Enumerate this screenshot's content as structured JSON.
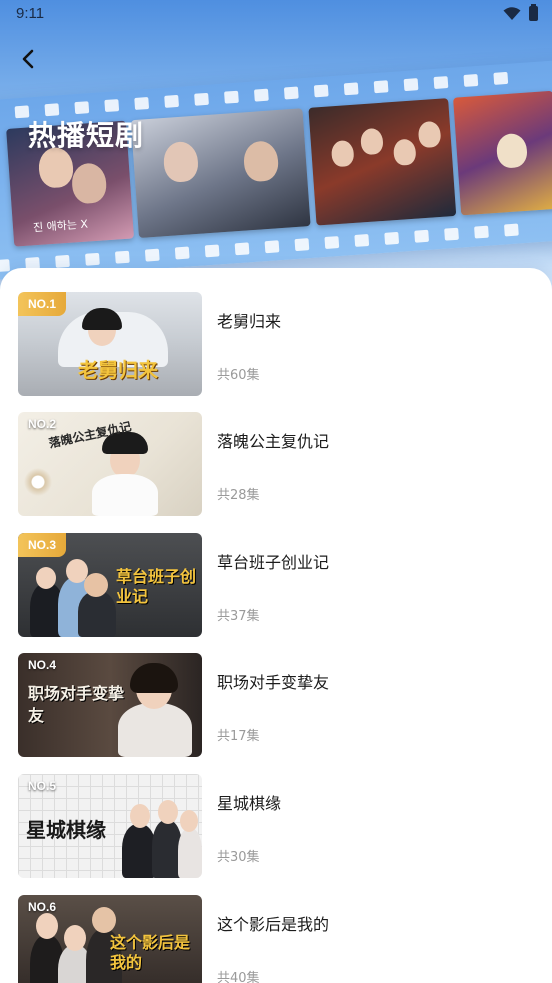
{
  "status_bar": {
    "time": "9:11"
  },
  "header": {
    "title": "热播短剧",
    "back_icon": "chevron-left-icon"
  },
  "banner": {
    "posters": [
      {
        "text": "진 애하는 X"
      },
      {
        "text": ""
      },
      {
        "text": ""
      },
      {
        "text": ""
      }
    ]
  },
  "list": [
    {
      "rank": "NO.1",
      "title": "老舅归来",
      "episodes": "共60集",
      "cover_caption": "老舅归来",
      "badge": "gold"
    },
    {
      "rank": "NO.2",
      "title": "落魄公主复仇记",
      "episodes": "共28集",
      "cover_caption": "落魄公主复仇记",
      "badge": "plain"
    },
    {
      "rank": "NO.3",
      "title": "草台班子创业记",
      "episodes": "共37集",
      "cover_caption": "草台班子创业记",
      "badge": "gold"
    },
    {
      "rank": "NO.4",
      "title": "职场对手变挚友",
      "episodes": "共17集",
      "cover_caption": "职场对手变挚友",
      "badge": "plain"
    },
    {
      "rank": "NO.5",
      "title": "星城棋缘",
      "episodes": "共30集",
      "cover_caption": "星城棋缘",
      "badge": "plain"
    },
    {
      "rank": "NO.6",
      "title": "这个影后是我的",
      "episodes": "共40集",
      "cover_caption": "这个影后是我的",
      "badge": "plain"
    }
  ],
  "colors": {
    "accent_gold": "#e6a93a",
    "header_blue": "#4f8fe0"
  }
}
